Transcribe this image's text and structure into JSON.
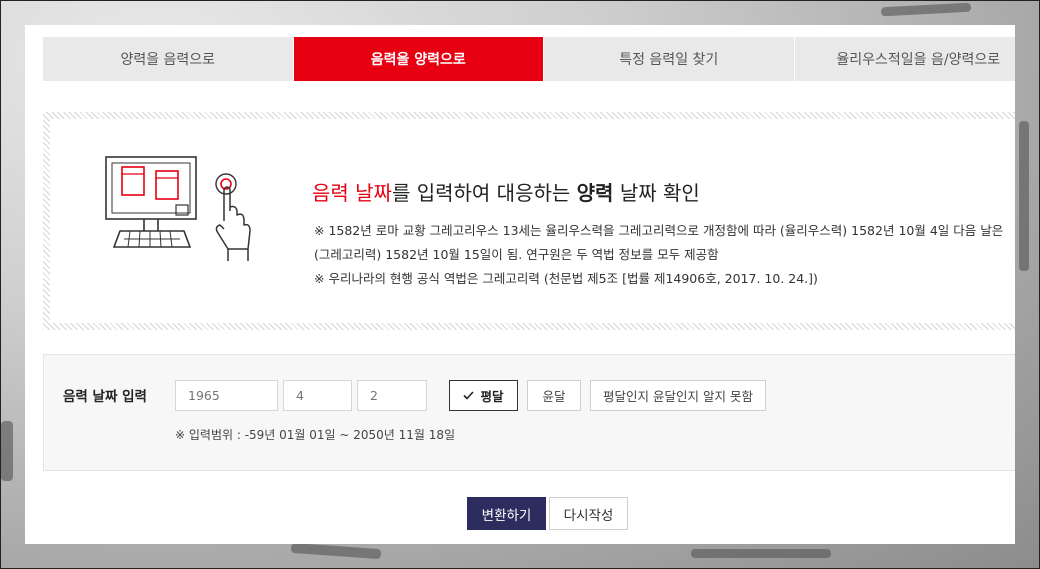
{
  "tabs": [
    {
      "label": "양력을 음력으로",
      "active": false
    },
    {
      "label": "음력을 양력으로",
      "active": true
    },
    {
      "label": "특정 음력일 찾기",
      "active": false
    },
    {
      "label": "율리우스적일을 음/양력으로",
      "active": false
    }
  ],
  "info": {
    "title_part1": "음력 날짜",
    "title_part2": "를 입력하여 대응하는 ",
    "title_part3": "양력",
    "title_part4": " 날짜 확인",
    "note1": "※ 1582년 로마 교황 그레고리우스 13세는 율리우스력을 그레고리력으로 개정함에 따라 (율리우스력) 1582년 10월 4일 다음 날은 (그레고리력) 1582년 10월 15일이 됨. 연구원은 두 역법 정보를 모두 제공함",
    "note2": "※ 우리나라의 현행 공식 역법은 그레고리력 (천문법 제5조 [법률 제14906호, 2017. 10. 24.])"
  },
  "input": {
    "label": "음력 날짜 입력",
    "year_placeholder": "1965",
    "month_placeholder": "4",
    "day_placeholder": "2",
    "options": [
      {
        "label": "평달",
        "selected": true
      },
      {
        "label": "윤달",
        "selected": false
      },
      {
        "label": "평달인지 윤달인지 알지 못함",
        "selected": false
      }
    ],
    "range_note": "※ 입력범위 : -59년 01월 01일 ~ 2050년 11월 18일"
  },
  "actions": {
    "convert_label": "변환하기",
    "reset_label": "다시작성"
  },
  "colors": {
    "accent_red": "#e60012",
    "convert_button": "#2c2c5e"
  },
  "icons": {
    "check": "check-icon",
    "illustration": "computer-touch-illustration"
  }
}
